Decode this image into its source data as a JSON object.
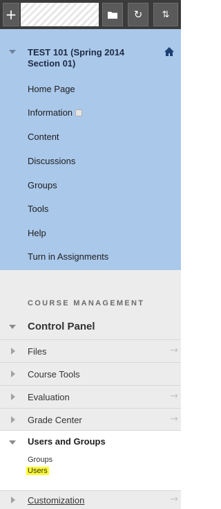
{
  "toolbar": {
    "add_icon": "+",
    "folder_icon": "📁",
    "refresh_icon": "↻",
    "sort_icon": "⇅"
  },
  "course": {
    "title": "TEST 101 (Spring 2014 Section 01)",
    "home_icon": "⌂",
    "menu": [
      {
        "label": "Home Page"
      },
      {
        "label": "Information"
      },
      {
        "label": "Content"
      },
      {
        "label": "Discussions"
      },
      {
        "label": "Groups"
      },
      {
        "label": "Tools"
      },
      {
        "label": "Help"
      },
      {
        "label": "Turn in Assignments"
      }
    ]
  },
  "management": {
    "heading": "COURSE MANAGEMENT",
    "control_panel": "Control Panel",
    "items": [
      {
        "label": "Files",
        "arrow": "→"
      },
      {
        "label": "Course Tools",
        "arrow": ""
      },
      {
        "label": "Evaluation",
        "arrow": "→"
      },
      {
        "label": "Grade Center",
        "arrow": "→"
      }
    ],
    "users_groups": {
      "title": "Users and Groups",
      "links": [
        "Groups",
        "Users"
      ]
    },
    "customization": {
      "label": "Customization",
      "arrow": "→"
    }
  },
  "colors": {
    "course_menu_bg": "#aac8ea",
    "toolbar_bg": "#3b3b3b",
    "highlight": "#fdfb2e"
  }
}
